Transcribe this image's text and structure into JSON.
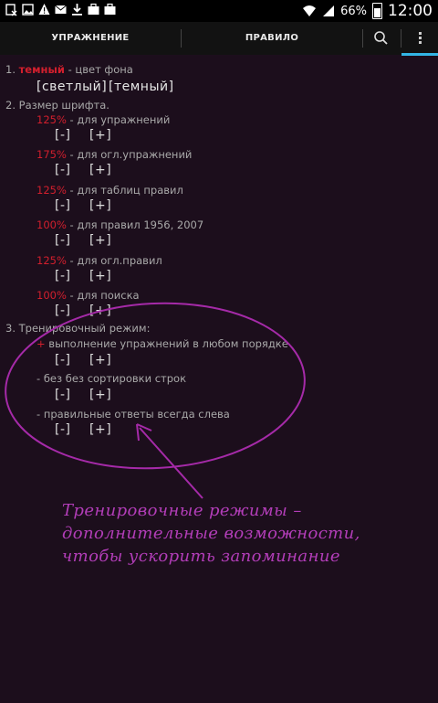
{
  "status_bar": {
    "battery": "66%",
    "time": "12:00",
    "icons": [
      "image-x-icon",
      "picture-icon",
      "warning-icon",
      "mail-icon",
      "download-icon",
      "briefcase-icon",
      "briefcase-icon",
      "wifi-icon",
      "signal-icon",
      "battery-icon"
    ]
  },
  "tabs": [
    {
      "label": "УПРАЖНЕНИЕ"
    },
    {
      "label": "ПРАВИЛО"
    }
  ],
  "accent_color": "#33b5e5",
  "highlight_color": "#d21f2d",
  "settings": {
    "background": {
      "number": "1.",
      "value": "темный",
      "label": "- цвет фона",
      "option_light": "[светлый]",
      "option_dark": "[темный]"
    },
    "font_size": {
      "heading": "2. Размер шрифта.",
      "items": [
        {
          "value": "125%",
          "label": "- для упражнений"
        },
        {
          "value": "175%",
          "label": "- для огл.упражнений"
        },
        {
          "value": "125%",
          "label": "- для таблиц правил"
        },
        {
          "value": "100%",
          "label": "- для правил 1956, 2007"
        },
        {
          "value": "125%",
          "label": "- для огл.правил"
        },
        {
          "value": "100%",
          "label": "- для поиска"
        }
      ]
    },
    "training": {
      "heading": "3. Тренировочный режим:",
      "items": [
        {
          "mark": "+",
          "label": "выполнение упражнений в любом порядке"
        },
        {
          "mark": "-",
          "label": "без без сортировки строк"
        },
        {
          "mark": "-",
          "label": "правильные ответы всегда слева"
        }
      ]
    },
    "minus_label": "[-]",
    "plus_label": "[+]"
  },
  "annotation": {
    "lines": [
      "Тренировочные режимы –",
      "дополнительные возможности,",
      "чтобы ускорить запоминание"
    ]
  }
}
